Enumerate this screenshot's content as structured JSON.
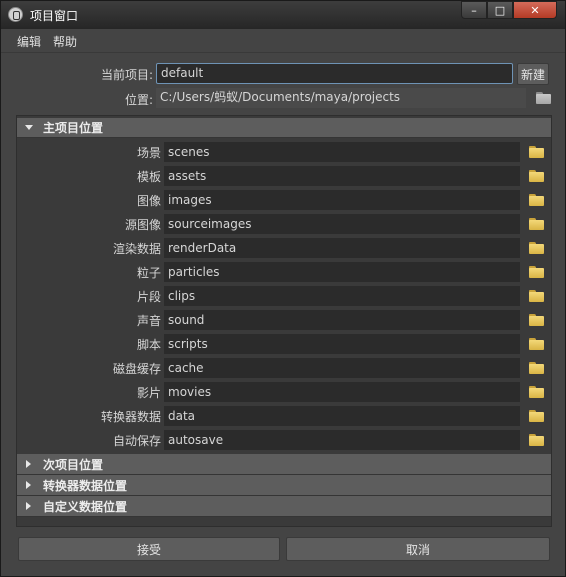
{
  "window": {
    "title": "项目窗口",
    "controls": {
      "minimize": "–",
      "maximize": "□",
      "close": "✕"
    }
  },
  "menu": [
    "编辑",
    "帮助"
  ],
  "current_project": {
    "label": "当前项目:",
    "value": "default",
    "new_button": "新建"
  },
  "location": {
    "label": "位置:",
    "value": "C:/Users/蚂蚁/Documents/maya/projects",
    "icon": "folder-icon"
  },
  "sections": {
    "primary": {
      "label": "主项目位置",
      "expanded": true,
      "rows": [
        {
          "label": "场景",
          "value": "scenes"
        },
        {
          "label": "模板",
          "value": "assets"
        },
        {
          "label": "图像",
          "value": "images"
        },
        {
          "label": "源图像",
          "value": "sourceimages"
        },
        {
          "label": "渲染数据",
          "value": "renderData"
        },
        {
          "label": "粒子",
          "value": "particles"
        },
        {
          "label": "片段",
          "value": "clips"
        },
        {
          "label": "声音",
          "value": "sound"
        },
        {
          "label": "脚本",
          "value": "scripts"
        },
        {
          "label": "磁盘缓存",
          "value": "cache"
        },
        {
          "label": "影片",
          "value": "movies"
        },
        {
          "label": "转换器数据",
          "value": "data"
        },
        {
          "label": "自动保存",
          "value": "autosave"
        }
      ]
    },
    "secondary": {
      "label": "次项目位置",
      "expanded": false
    },
    "translator": {
      "label": "转换器数据位置",
      "expanded": false
    },
    "custom": {
      "label": "自定义数据位置",
      "expanded": false
    }
  },
  "buttons": {
    "accept": "接受",
    "cancel": "取消"
  },
  "colors": {
    "window_bg": "#444444",
    "panel_bg": "#3a3a3a",
    "header_bg": "#5d5d5d",
    "field_bg": "#2b2b2b",
    "focus_border": "#6e93b5",
    "folder_yellow": "#e6c453",
    "close_red": "#c14a35"
  }
}
